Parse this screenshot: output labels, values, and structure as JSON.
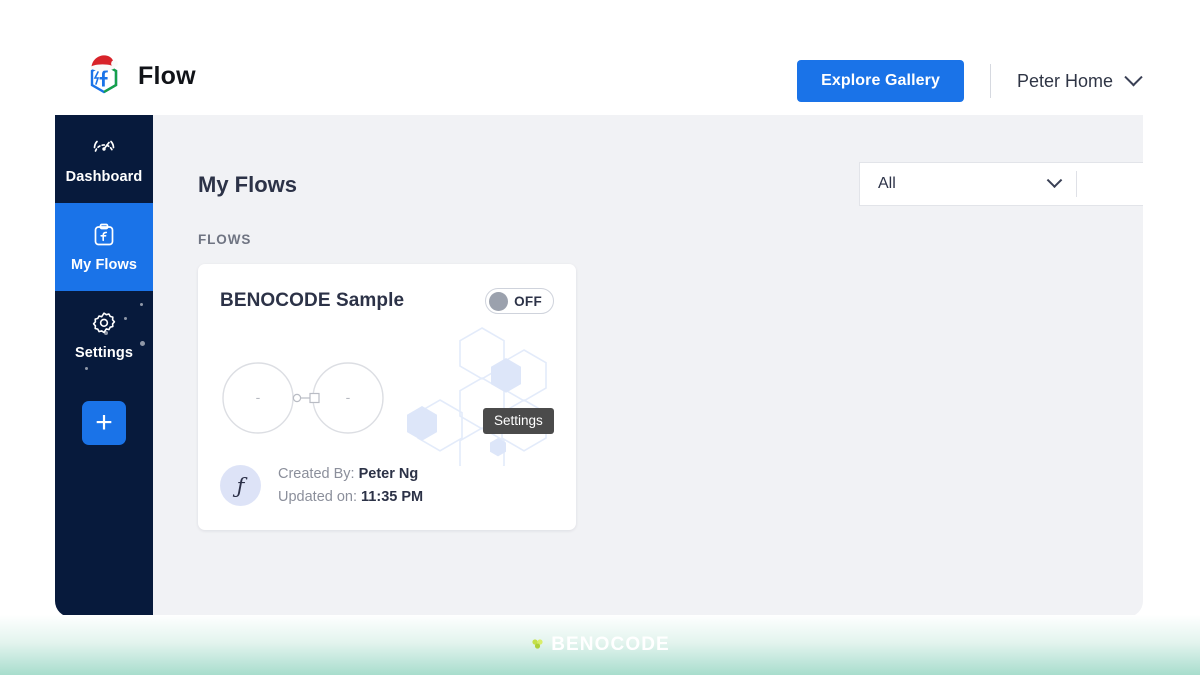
{
  "app": {
    "brand_name": "Flow",
    "logo_icon": "hexagon-flow-logo-with-santa-hat"
  },
  "header": {
    "explore_button": "Explore Gallery",
    "user_name": "Peter Home",
    "user_chevron_icon": "chevron-down-icon"
  },
  "sidebar": {
    "items": [
      {
        "label": "Dashboard",
        "icon": "gauge-icon",
        "active": false
      },
      {
        "label": "My Flows",
        "icon": "clipboard-f-icon",
        "active": true
      },
      {
        "label": "Settings",
        "icon": "gear-icon",
        "active": false
      }
    ],
    "add_button": "+",
    "add_button_icon": "plus-icon"
  },
  "main": {
    "page_title": "My Flows",
    "section_label": "FLOWS",
    "filter": {
      "selected": "All",
      "chevron_icon": "chevron-down-icon"
    }
  },
  "flow_card": {
    "title": "BENOCODE Sample",
    "toggle_state": "OFF",
    "toggle_on": false,
    "tooltip": "Settings",
    "avatar_glyph": "ƒ",
    "created_by_label": "Created By:",
    "created_by_value": "Peter Ng",
    "updated_label": "Updated on:",
    "updated_value": "11:35 PM",
    "preview": {
      "node_left_label": "-",
      "node_right_label": "-"
    }
  },
  "footer": {
    "brand_text": "BENOCODE",
    "mark_icon": "benocode-dots-icon"
  },
  "colors": {
    "accent_blue": "#1a73e8",
    "sidebar_navy": "#071a3c",
    "content_bg": "#f1f2f5",
    "text_dark": "#2c3247",
    "tooltip_bg": "#4b4b4b",
    "band_green": "#a8ddcd"
  }
}
